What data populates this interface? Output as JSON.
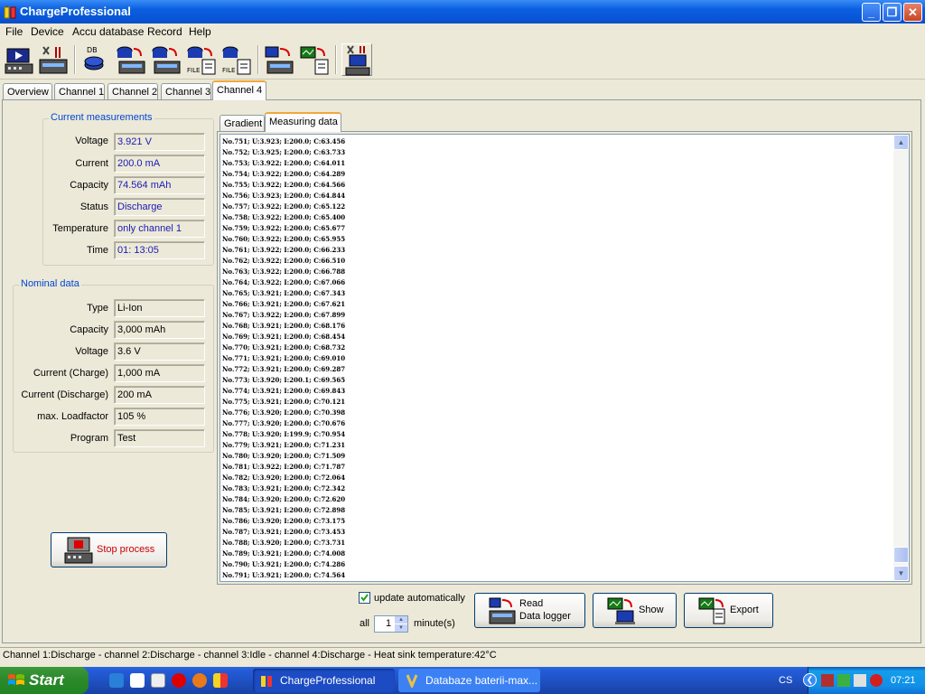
{
  "window": {
    "title": "ChargeProfessional"
  },
  "menu": [
    "File",
    "Device",
    "Accu database",
    "Record",
    "Help"
  ],
  "toolbar": {
    "buttons": [
      "start-device",
      "device-settings",
      "database",
      "db-to-device",
      "device-to-db",
      "db-to-file",
      "file-to-db",
      "pc-to-device",
      "device-to-file",
      "data-logger"
    ],
    "labels": {
      "db": "DB",
      "file": "FILE"
    }
  },
  "tabs": [
    "Overview",
    "Channel 1",
    "Channel 2",
    "Channel 3",
    "Channel 4"
  ],
  "active_tab": "Channel 4",
  "current_measurements": {
    "title": "Current measurements",
    "rows": [
      {
        "label": "Voltage",
        "value": "3.921 V"
      },
      {
        "label": "Current",
        "value": "200.0 mA"
      },
      {
        "label": "Capacity",
        "value": "74.564 mAh"
      },
      {
        "label": "Status",
        "value": "Discharge"
      },
      {
        "label": "Temperature",
        "value": "only channel 1"
      },
      {
        "label": "Time",
        "value": "01: 13:05"
      }
    ]
  },
  "nominal_data": {
    "title": "Nominal data",
    "rows": [
      {
        "label": "Type",
        "value": "Li-Ion"
      },
      {
        "label": "Capacity",
        "value": "3,000 mAh"
      },
      {
        "label": "Voltage",
        "value": "3.6 V"
      },
      {
        "label": "Current (Charge)",
        "value": "1,000 mA"
      },
      {
        "label": "Current (Discharge)",
        "value": "200 mA"
      },
      {
        "label": "max. Loadfactor",
        "value": "105 %"
      },
      {
        "label": "Program",
        "value": "Test"
      }
    ]
  },
  "stop_button": {
    "label": "Stop process"
  },
  "inner_tabs": [
    "Gradient",
    "Measuring data"
  ],
  "active_inner_tab": "Measuring data",
  "log_lines": [
    "No.751; U:3.923; I:200.0; C:63.456",
    "No.752; U:3.925; I:200.0; C:63.733",
    "No.753; U:3.922; I:200.0; C:64.011",
    "No.754; U:3.922; I:200.0; C:64.289",
    "No.755; U:3.922; I:200.0; C:64.566",
    "No.756; U:3.923; I:200.0; C:64.844",
    "No.757; U:3.922; I:200.0; C:65.122",
    "No.758; U:3.922; I:200.0; C:65.400",
    "No.759; U:3.922; I:200.0; C:65.677",
    "No.760; U:3.922; I:200.0; C:65.955",
    "No.761; U:3.922; I:200.0; C:66.233",
    "No.762; U:3.922; I:200.0; C:66.510",
    "No.763; U:3.922; I:200.0; C:66.788",
    "No.764; U:3.922; I:200.0; C:67.066",
    "No.765; U:3.921; I:200.0; C:67.343",
    "No.766; U:3.921; I:200.0; C:67.621",
    "No.767; U:3.922; I:200.0; C:67.899",
    "No.768; U:3.921; I:200.0; C:68.176",
    "No.769; U:3.921; I:200.0; C:68.454",
    "No.770; U:3.921; I:200.0; C:68.732",
    "No.771; U:3.921; I:200.0; C:69.010",
    "No.772; U:3.921; I:200.0; C:69.287",
    "No.773; U:3.920; I:200.1; C:69.565",
    "No.774; U:3.921; I:200.0; C:69.843",
    "No.775; U:3.921; I:200.0; C:70.121",
    "No.776; U:3.920; I:200.0; C:70.398",
    "No.777; U:3.920; I:200.0; C:70.676",
    "No.778; U:3.920; I:199.9; C:70.954",
    "No.779; U:3.921; I:200.0; C:71.231",
    "No.780; U:3.920; I:200.0; C:71.509",
    "No.781; U:3.922; I:200.0; C:71.787",
    "No.782; U:3.920; I:200.0; C:72.064",
    "No.783; U:3.921; I:200.0; C:72.342",
    "No.784; U:3.920; I:200.0; C:72.620",
    "No.785; U:3.921; I:200.0; C:72.898",
    "No.786; U:3.920; I:200.0; C:73.175",
    "No.787; U:3.921; I:200.0; C:73.453",
    "No.788; U:3.920; I:200.0; C:73.731",
    "No.789; U:3.921; I:200.0; C:74.008",
    "No.790; U:3.921; I:200.0; C:74.286",
    "No.791; U:3.921; I:200.0; C:74.564"
  ],
  "update": {
    "checkbox_label": "update automatically",
    "checked": true,
    "all_label": "all",
    "minutes_value": "1",
    "minutes_label": "minute(s)"
  },
  "actions": {
    "read_logger": [
      "Read",
      "Data logger"
    ],
    "show": "Show",
    "export": "Export"
  },
  "status_bar": "Channel 1:Discharge - channel 2:Discharge - channel 3:Idle - channel 4:Discharge - Heat sink temperature:42°C",
  "taskbar": {
    "start": "Start",
    "tasks": [
      "ChargeProfessional",
      "Databaze baterii-max..."
    ],
    "language": "CS",
    "clock": "07:21"
  },
  "colors": {
    "title_blue": "#0a5fe0",
    "value_blue": "#1a1ab5",
    "group_title": "#0046d5",
    "stop_red": "#cc0000",
    "start_green": "#2d8a2d"
  }
}
